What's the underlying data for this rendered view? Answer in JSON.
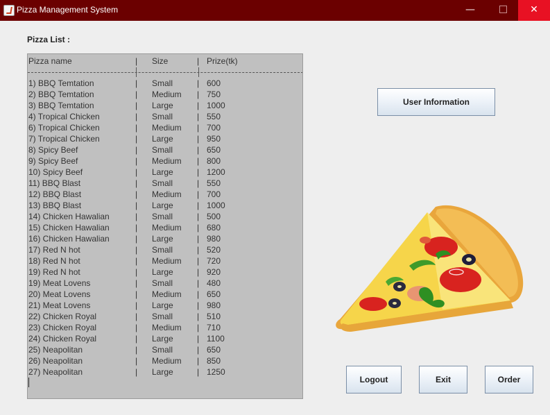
{
  "window": {
    "title": "Pizza Management System",
    "minimize_glyph": "—",
    "close_glyph": "✕"
  },
  "pizza_list": {
    "label": "Pizza List :",
    "headers": {
      "name": "Pizza name",
      "sep": "|",
      "size": "Size",
      "price": "Prize(tk)"
    },
    "rows": [
      {
        "name": "1) BBQ Temtation",
        "size": "Small",
        "price": "600"
      },
      {
        "name": "2) BBQ Temtation",
        "size": "Medium",
        "price": "750"
      },
      {
        "name": "3) BBQ Temtation",
        "size": "Large",
        "price": "1000"
      },
      {
        "name": "4) Tropical Chicken",
        "size": "Small",
        "price": "550"
      },
      {
        "name": "6) Tropical Chicken",
        "size": "Medium",
        "price": "700"
      },
      {
        "name": "7) Tropical Chicken",
        "size": "Large",
        "price": "950"
      },
      {
        "name": "8) Spicy Beef",
        "size": "Small",
        "price": "650"
      },
      {
        "name": "9) Spicy Beef",
        "size": "Medium",
        "price": "800"
      },
      {
        "name": "10) Spicy Beef",
        "size": "Large",
        "price": "1200"
      },
      {
        "name": "11) BBQ Blast",
        "size": "Small",
        "price": "550"
      },
      {
        "name": "12) BBQ Blast",
        "size": "Medium",
        "price": "700"
      },
      {
        "name": "13) BBQ Blast",
        "size": "Large",
        "price": "1000"
      },
      {
        "name": "14) Chicken Hawalian",
        "size": "Small",
        "price": "500"
      },
      {
        "name": "15) Chicken Hawalian",
        "size": "Medium",
        "price": "680"
      },
      {
        "name": "16) Chicken Hawalian",
        "size": "Large",
        "price": "980"
      },
      {
        "name": "17) Red N hot",
        "size": "Small",
        "price": "520"
      },
      {
        "name": "18) Red N hot",
        "size": "Medium",
        "price": "720"
      },
      {
        "name": "19) Red N hot",
        "size": "Large",
        "price": "920"
      },
      {
        "name": "19) Meat Lovens",
        "size": "Small",
        "price": "480"
      },
      {
        "name": "20) Meat Lovens",
        "size": "Medium",
        "price": "650"
      },
      {
        "name": "21) Meat Lovens",
        "size": "Large",
        "price": "980"
      },
      {
        "name": "22) Chicken Royal",
        "size": "Small",
        "price": "510"
      },
      {
        "name": "23) Chicken Royal",
        "size": "Medium",
        "price": "710"
      },
      {
        "name": "24) Chicken Royal",
        "size": "Large",
        "price": "1100"
      },
      {
        "name": "25) Neapolitan",
        "size": "Small",
        "price": "650"
      },
      {
        "name": "26) Neapolitan",
        "size": "Medium",
        "price": "850"
      },
      {
        "name": "27) Neapolitan",
        "size": "Large",
        "price": "1250"
      }
    ]
  },
  "buttons": {
    "user_information": "User Information",
    "logout": "Logout",
    "exit": "Exit",
    "order": "Order"
  },
  "icons": {
    "app": "java-cup-icon",
    "illustration": "pizza-slice-icon"
  },
  "colors": {
    "titlebar": "#6b0000",
    "close_button": "#e81123",
    "list_background": "#c0c0c0"
  }
}
